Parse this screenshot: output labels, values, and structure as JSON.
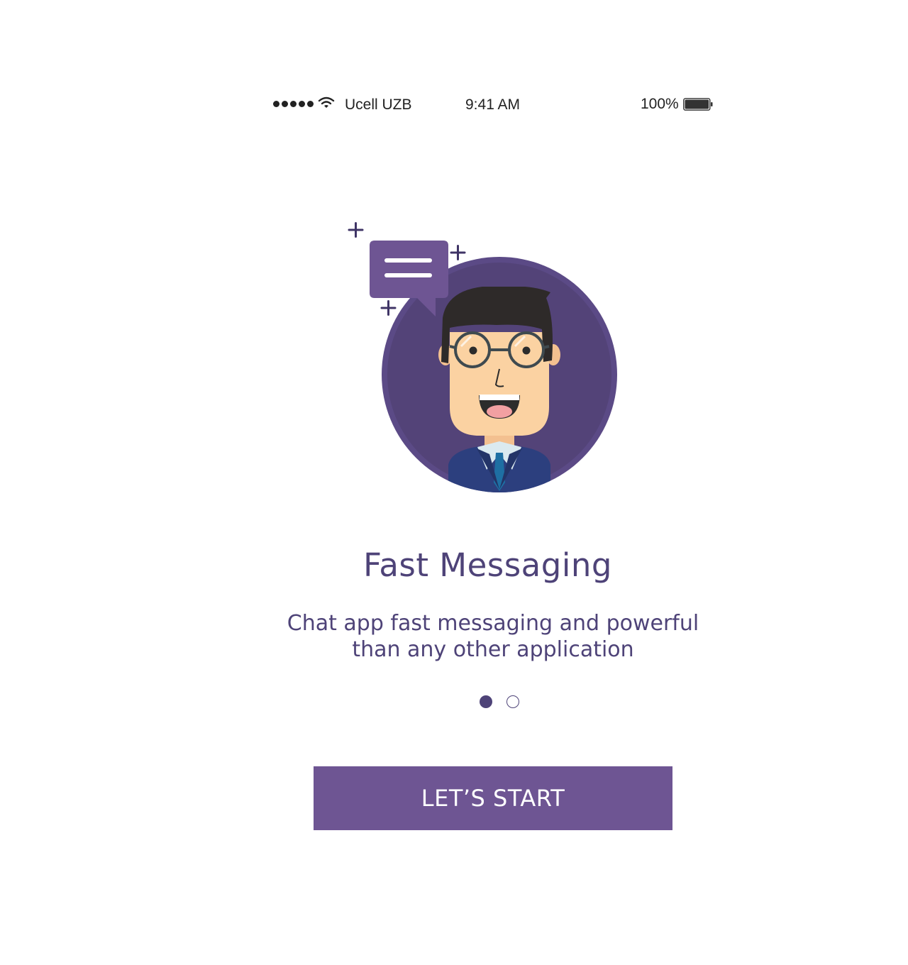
{
  "status_bar": {
    "carrier": "Ucell UZB",
    "time": "9:41 AM",
    "battery_percent": "100%",
    "signal_bars": 5,
    "icons": [
      "signal-dots-icon",
      "wifi-icon",
      "battery-icon"
    ]
  },
  "onboarding": {
    "title": "Fast Messaging",
    "subtitle": "Chat app fast messaging and powerful than any other application",
    "page_indicator": {
      "current": 1,
      "total": 2
    },
    "illustration": [
      "chat-bubble-icon",
      "avatar-man-with-glasses",
      "sparkle-plus-icon"
    ]
  },
  "actions": {
    "start_label": "LET’S START"
  },
  "colors": {
    "accent": "#6e5593",
    "text": "#4e4378",
    "avatar_circle": "#534378"
  }
}
